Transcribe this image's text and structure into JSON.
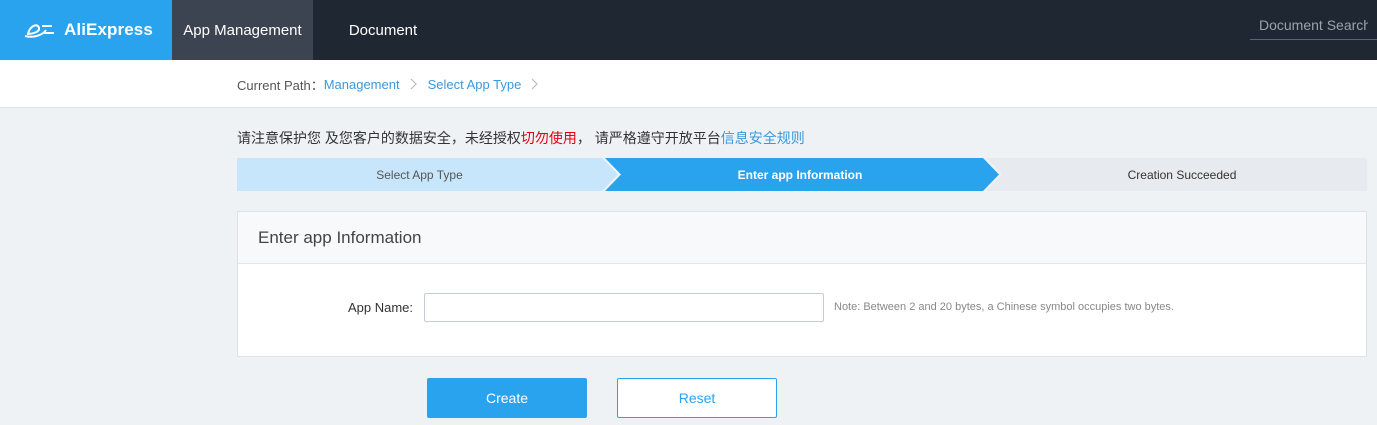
{
  "nav": {
    "brand": "AliExpress",
    "items": [
      {
        "label": "App Management",
        "active": true
      },
      {
        "label": "Document",
        "active": false
      }
    ],
    "search_placeholder": "Document Search"
  },
  "breadcrumb": {
    "prefix": "Current Path：",
    "items": [
      "Management",
      "Select App Type"
    ]
  },
  "notice": {
    "part1": "请注意保护您 及您客户的数据安全，未经授权",
    "warning": "切勿使用",
    "part2": "，  请严格遵守开放平台",
    "link": "信息安全规则"
  },
  "steps": [
    {
      "label": "Select App Type",
      "state": "done"
    },
    {
      "label": "Enter app Information",
      "state": "active"
    },
    {
      "label": "Creation Succeeded",
      "state": "pending"
    }
  ],
  "form": {
    "title": "Enter app Information",
    "app_name_label": "App Name:",
    "app_name_value": "",
    "app_name_note": "Note: Between 2 and 20 bytes, a Chinese symbol occupies two bytes."
  },
  "buttons": {
    "create": "Create",
    "reset": "Reset"
  },
  "colors": {
    "accent": "#2aa3ef",
    "nav_bg": "#1f2733",
    "nav_active": "#3b4450",
    "step_done": "#c7e6fb",
    "step_pending": "#e7ebef",
    "warning": "#e60012"
  }
}
